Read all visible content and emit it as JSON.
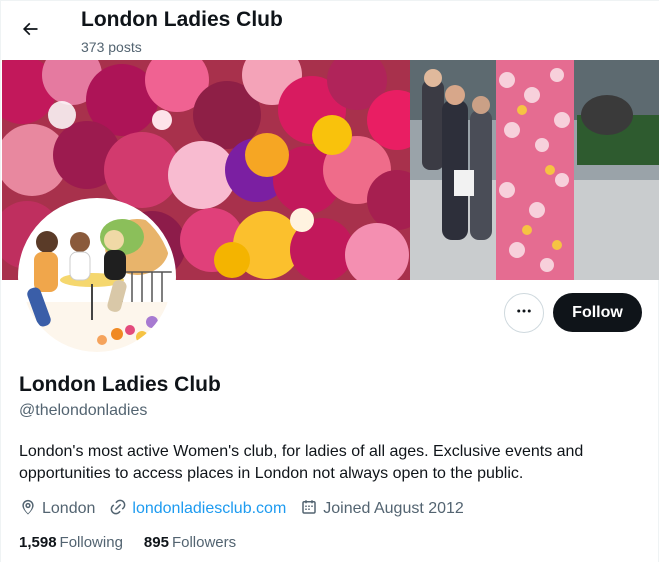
{
  "header": {
    "title": "London Ladies Club",
    "posts_count": "373 posts"
  },
  "profile": {
    "display_name": "London Ladies Club",
    "handle": "@thelondonladies",
    "bio": "London's most active Women's club, for ladies of all ages. Exclusive events and opportunities to access places in London not always open to the public.",
    "location": "London",
    "website": "londonladiesclub.com",
    "joined": "Joined August 2012",
    "following_count": "1,598",
    "following_label": "Following",
    "followers_count": "895",
    "followers_label": "Followers"
  },
  "actions": {
    "follow_label": "Follow"
  },
  "icons": {
    "back": "arrow-left-icon",
    "more": "more-dots-icon",
    "location": "location-pin-icon",
    "link": "link-icon",
    "calendar": "calendar-icon"
  },
  "colors": {
    "text_primary": "#0f1419",
    "text_secondary": "#536471",
    "link": "#1d9bf0",
    "follow_button_bg": "#0f1419",
    "follow_button_text": "#ffffff"
  }
}
